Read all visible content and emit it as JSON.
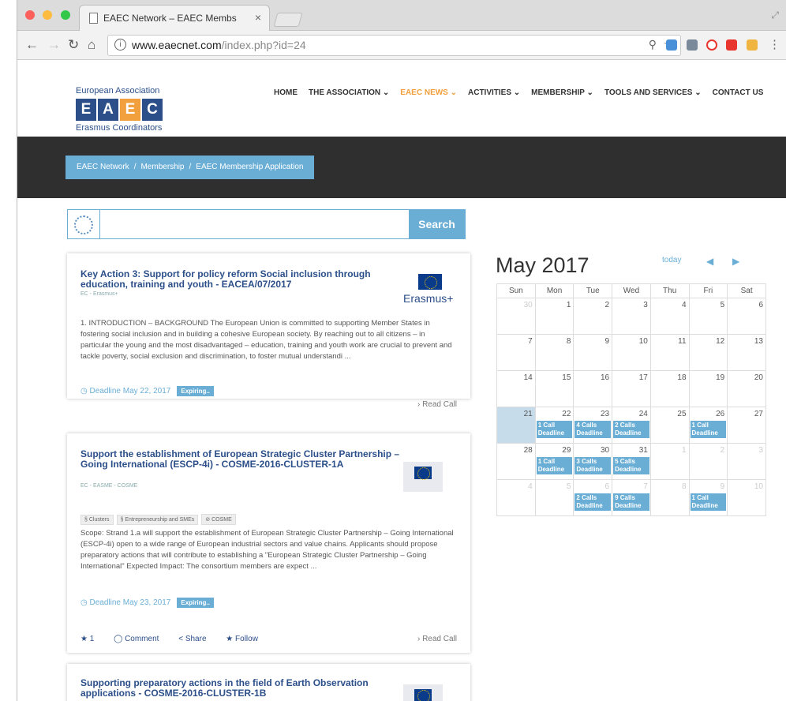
{
  "browser": {
    "tab_title": "EAEC Network – EAEC Membs",
    "tab_close": "×",
    "url_host": "www.eaecnet.com",
    "url_path": "/index.php?id=24",
    "info_glyph": "i",
    "zoom_glyph": "⚲",
    "star_glyph": "☆",
    "menu_glyph": "⋮"
  },
  "site": {
    "logo_top": "European Association",
    "logo_letters": [
      "E",
      "A",
      "E",
      "C"
    ],
    "logo_colors": [
      "#2c4f8a",
      "#2c4f8a",
      "#f2a03d",
      "#2c4f8a"
    ],
    "logo_bottom": "Erasmus Coordinators",
    "nav": [
      {
        "label": "HOME",
        "active": false
      },
      {
        "label": "THE ASSOCIATION ⌄",
        "active": false
      },
      {
        "label": "EAEC NEWS ⌄",
        "active": true
      },
      {
        "label": "ACTIVITIES ⌄",
        "active": false
      },
      {
        "label": "MEMBERSHIP ⌄",
        "active": false
      },
      {
        "label": "TOOLS AND SERVICES ⌄",
        "active": false
      },
      {
        "label": "CONTACT US",
        "active": false
      }
    ],
    "breadcrumb": [
      "EAEC Network",
      "Membership",
      "EAEC Membership Application"
    ],
    "breadcrumb_sep": "/",
    "accent_color": "#6aaed6"
  },
  "search": {
    "button": "Search",
    "placeholder": ""
  },
  "cards": [
    {
      "title": "Key Action 3: Support for policy reform Social inclusion through education, training and youth - EACEA/07/2017",
      "source": "EC - Erasmus+",
      "logo_text": "Erasmus+",
      "body": "1. INTRODUCTION – BACKGROUND The European Union is committed to supporting Member States in fostering social inclusion and in building a cohesive European society. By reaching out to all citizens – in particular the young and the most disadvantaged – education, training and youth work are crucial to prevent and tackle poverty, social exclusion and discrimination, to foster mutual understandi ...",
      "deadline": "Deadline May 22, 2017",
      "badge": "Expiring..",
      "read": "› Read Call"
    },
    {
      "title": "Support the establishment of European Strategic Cluster Partnership – Going International (ESCP-4i) - COSME-2016-CLUSTER-1A",
      "source": "EC - EASME - COSME",
      "tags": [
        "§ Clusters",
        "§ Entrepreneurship and SMEs",
        "⊘ COSME"
      ],
      "body": "Scope: Strand 1.a will support the establishment of European Strategic Cluster Partnership – Going International (ESCP-4i) open to a wide range of European industrial sectors and value chains. Applicants should propose preparatory actions that will contribute to establishing a \"European Strategic Cluster Partnership – Going International\" Expected Impact: The consortium members are expect ...",
      "deadline": "Deadline May 23, 2017",
      "badge": "Expiring..",
      "likes": "★ 1",
      "comment": "◯ Comment",
      "share": "< Share",
      "follow": "★ Follow",
      "read": "› Read Call"
    },
    {
      "title": "Supporting preparatory actions in the field of Earth Observation applications - COSME-2016-CLUSTER-1B"
    }
  ],
  "calendar": {
    "title": "May 2017",
    "today_label": "today",
    "prev_glyph": "◀",
    "next_glyph": "▶",
    "weekdays": [
      "Sun",
      "Mon",
      "Tue",
      "Wed",
      "Thu",
      "Fri",
      "Sat"
    ],
    "weeks": [
      [
        {
          "d": "30",
          "o": true
        },
        {
          "d": "1"
        },
        {
          "d": "2"
        },
        {
          "d": "3"
        },
        {
          "d": "4"
        },
        {
          "d": "5"
        },
        {
          "d": "6"
        }
      ],
      [
        {
          "d": "7"
        },
        {
          "d": "8"
        },
        {
          "d": "9"
        },
        {
          "d": "10"
        },
        {
          "d": "11"
        },
        {
          "d": "12"
        },
        {
          "d": "13"
        }
      ],
      [
        {
          "d": "14"
        },
        {
          "d": "15"
        },
        {
          "d": "16"
        },
        {
          "d": "17"
        },
        {
          "d": "18"
        },
        {
          "d": "19"
        },
        {
          "d": "20"
        }
      ],
      [
        {
          "d": "21",
          "today": true
        },
        {
          "d": "22",
          "ev": "1 Call Deadline"
        },
        {
          "d": "23",
          "ev": "4 Calls Deadline"
        },
        {
          "d": "24",
          "ev": "2 Calls Deadline"
        },
        {
          "d": "25"
        },
        {
          "d": "26",
          "ev": "1 Call Deadline"
        },
        {
          "d": "27"
        }
      ],
      [
        {
          "d": "28"
        },
        {
          "d": "29",
          "ev": "1 Call Deadline"
        },
        {
          "d": "30",
          "ev": "3 Calls Deadline"
        },
        {
          "d": "31",
          "ev": "5 Calls Deadline"
        },
        {
          "d": "1",
          "o": true
        },
        {
          "d": "2",
          "o": true
        },
        {
          "d": "3",
          "o": true
        }
      ],
      [
        {
          "d": "4",
          "o": true
        },
        {
          "d": "5",
          "o": true
        },
        {
          "d": "6",
          "o": true,
          "ev": "2 Calls Deadline"
        },
        {
          "d": "7",
          "o": true,
          "ev": "9 Calls Deadline"
        },
        {
          "d": "8",
          "o": true
        },
        {
          "d": "9",
          "o": true,
          "ev": "1 Call Deadline"
        },
        {
          "d": "10",
          "o": true
        }
      ]
    ]
  }
}
